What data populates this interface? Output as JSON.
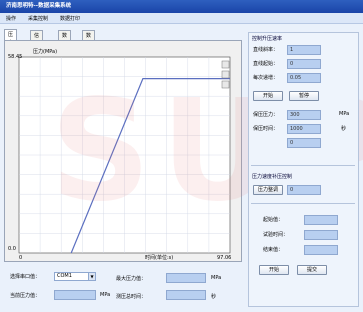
{
  "window": {
    "title": "济南思明特--数据采集系统"
  },
  "menu": [
    "操作",
    "采集控制",
    "数据打印"
  ],
  "tabs": [
    "压力曲线",
    "信息填写",
    "数据库",
    "数据回放"
  ],
  "chart": {
    "title": "压力(MPa)",
    "xlabel": "时间(单位:s)",
    "y_top": "58.45",
    "y_bottom": "0.0",
    "x_left": "0",
    "x_right": "97.06"
  },
  "chart_data": {
    "type": "line",
    "title": "压力(MPa)",
    "xlabel": "时间(单位:s)",
    "ylabel": "压力(MPa)",
    "xlim": [
      0,
      97.06
    ],
    "ylim": [
      0,
      58.45
    ],
    "series": [
      {
        "values": [
          [
            24,
            0
          ],
          [
            57,
            52
          ],
          [
            97.06,
            52
          ]
        ]
      }
    ],
    "grid": true
  },
  "side": {
    "control_title": "控制升压速率",
    "rise_rate_label": "直线斜率：",
    "rise_rate_value": "1",
    "start_label": "直线起始：",
    "start_value": "0",
    "step_label": "每次递增：",
    "step_value": "0.05",
    "start_btn": "开始",
    "pause_btn": "暂停",
    "hold_pressure_label": "保压压力：",
    "hold_pressure_value": "300",
    "hold_pressure_unit": "MPa",
    "hold_time_label": "保压时间：",
    "hold_time_value": "1000",
    "hold_time_unit": "秒",
    "extra_value": "0",
    "rate_group_title": "压力速度补压控制",
    "pressure_adj_btn": "压力整调",
    "pressure_adj_value": "0",
    "start_val_label": "起始值：",
    "test_time_label": "试验时间：",
    "end_val_label": "结束值：",
    "run_btn": "开始",
    "submit_btn": "提交"
  },
  "bottom": {
    "port_label": "选择串口值：",
    "port_value": "COM1",
    "max_pressure_label": "最大压力值：",
    "max_pressure_unit": "MPa",
    "current_pressure_label": "当前压力值：",
    "current_pressure_unit": "MPa",
    "total_time_label": "测压总时间：",
    "total_time_unit": "秒"
  },
  "watermark": "SUP"
}
